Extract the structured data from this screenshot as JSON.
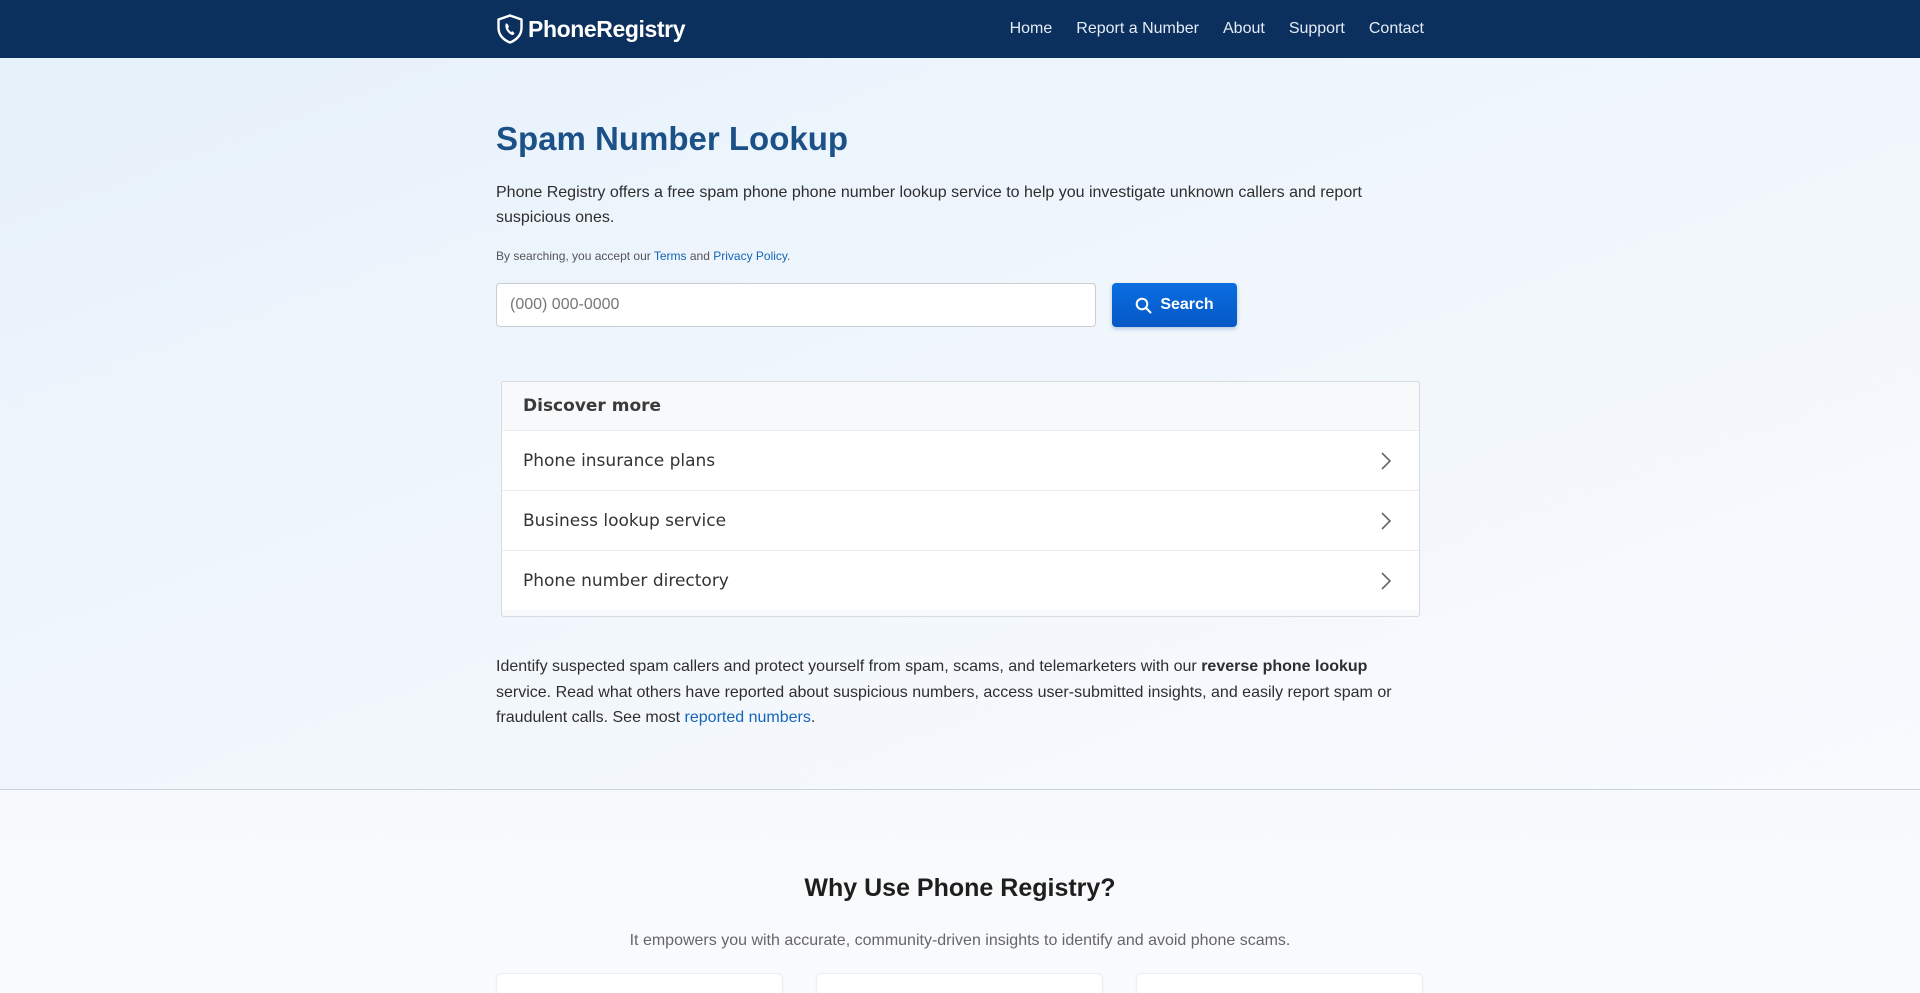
{
  "header": {
    "brand": "PhoneRegistry",
    "nav": [
      "Home",
      "Report a Number",
      "About",
      "Support",
      "Contact"
    ]
  },
  "hero": {
    "title": "Spam Number Lookup",
    "intro": "Phone Registry offers a free spam phone phone number lookup service to help you investigate unknown callers and report suspicious ones.",
    "terms_prefix": "By searching, you accept our ",
    "terms_link": "Terms",
    "terms_and": " and ",
    "privacy_link": "Privacy Policy",
    "terms_suffix": ".",
    "search_placeholder": "(000) 000-0000",
    "search_value": "",
    "search_button": "Search"
  },
  "discover": {
    "title": "Discover more",
    "items": [
      "Phone insurance plans",
      "Business lookup service",
      "Phone number directory"
    ]
  },
  "description": {
    "text1": "Identify suspected spam callers and protect yourself from spam, scams, and telemarketers with our ",
    "bold": "reverse phone lookup",
    "text2": " service. Read what others have reported about suspicious numbers, access user-submitted insights, and easily report spam or fraudulent calls. See most ",
    "link": "reported numbers",
    "text3": "."
  },
  "why": {
    "title": "Why Use Phone Registry?",
    "subtitle": "It empowers you with accurate, community-driven insights to identify and avoid phone scams."
  },
  "colors": {
    "header_bg": "#0c305e",
    "title": "#1c5188",
    "accent": "#0a6ee0",
    "link": "#1565b7"
  },
  "icons": {
    "logo": "shield-phone-icon",
    "search": "magnifier-icon",
    "chevron": "chevron-right-icon"
  }
}
